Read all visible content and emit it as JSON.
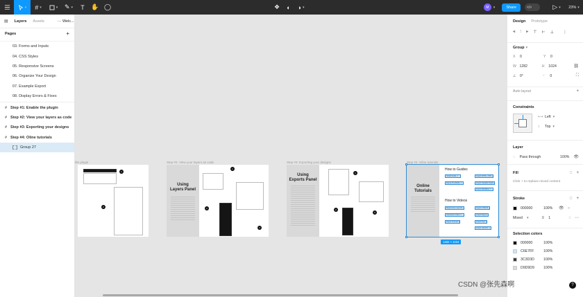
{
  "toolbar": {
    "tools": [
      "figma-menu-icon",
      "move-tool-icon",
      "frame-tool-icon",
      "shape-tool-icon",
      "pen-tool-icon",
      "text-tool-icon",
      "hand-tool-icon",
      "comment-tool-icon"
    ],
    "avatar_initial": "M",
    "share_label": "Share",
    "toggle_label": "</>",
    "zoom": "23%"
  },
  "left_panel": {
    "tabs": [
      "Layers",
      "Assets",
      "⋯ Welc..."
    ],
    "pages_title": "Pages",
    "pages": [
      {
        "label": "03. Forms and Inputs",
        "type": "page"
      },
      {
        "label": "04. CSS Styles",
        "type": "page"
      },
      {
        "label": "05. Responsive Screens",
        "type": "page"
      },
      {
        "label": "06. Organize Your Design",
        "type": "page"
      },
      {
        "label": "07. Example Export",
        "type": "page"
      },
      {
        "label": "08. Display Errors & Fixes",
        "type": "page"
      },
      {
        "label": "Step #1: Enable the plugin",
        "type": "frame"
      },
      {
        "label": "Step #2: View your layers as code",
        "type": "frame"
      },
      {
        "label": "Step #3: Exporting your designs",
        "type": "frame"
      },
      {
        "label": "Step #4: Oline tutorials",
        "type": "frame"
      },
      {
        "label": "Group 27",
        "type": "group"
      }
    ]
  },
  "canvas": {
    "frames": [
      {
        "label": "Step #1: Enable the plugin",
        "visible_label": "ble plugin"
      },
      {
        "label": "Step #2: View your layers as code",
        "title": "Using\nLayers Panel"
      },
      {
        "label": "Step #3: Exporting your designs",
        "title": "Using\nExports Panel"
      },
      {
        "label": "Step #4: Oline tutorials",
        "title": "Online\nTutorials",
        "guides_heading": "How to Guides",
        "videos_heading": "How to Videos"
      }
    ],
    "guides": [
      "Install Guide ↗",
      "Import HTML, CSS ↗",
      "Figma-To-Mobile ↗",
      "Import Variable Styles ↗",
      "Import Workflow ↗"
    ],
    "videos": [
      "Responsive Layouts ↗",
      "Import CSS/JS ↗",
      "Interactive Video ↗",
      "Import Figma ↗",
      "Figma Tutorial ↗",
      "Import Tips ↗",
      "Import JavaTG ↗"
    ],
    "selection_size": "1282 × 1024"
  },
  "right_panel": {
    "tabs": [
      "Design",
      "Prototype"
    ],
    "group": {
      "title": "Group",
      "x": "0",
      "y": "0",
      "w": "1282",
      "h": "1024",
      "rotation": "0°",
      "radius": "0"
    },
    "auto_layout": "Auto layout",
    "constraints": {
      "title": "Constraints",
      "horizontal": "Left",
      "vertical": "Top"
    },
    "layer": {
      "title": "Layer",
      "blend": "Pass through",
      "opacity": "100%"
    },
    "fill": {
      "title": "Fill",
      "placeholder": "Click + to replace mixed content"
    },
    "stroke": {
      "title": "Stroke",
      "color": "000000",
      "opacity": "100%",
      "position": "Mixed",
      "weight": "1"
    },
    "selection_colors": {
      "title": "Selection colors",
      "items": [
        {
          "hex": "000000",
          "opacity": "100%",
          "color": "#000000"
        },
        {
          "hex": "C6E7FF",
          "opacity": "100%",
          "color": "#C6E7FF"
        },
        {
          "hex": "3C3D3D",
          "opacity": "100%",
          "color": "#3C3D3D"
        },
        {
          "hex": "D9D9D9",
          "opacity": "100%",
          "color": "#D9D9D9"
        }
      ]
    }
  },
  "watermark": "CSDN @张先森啊"
}
